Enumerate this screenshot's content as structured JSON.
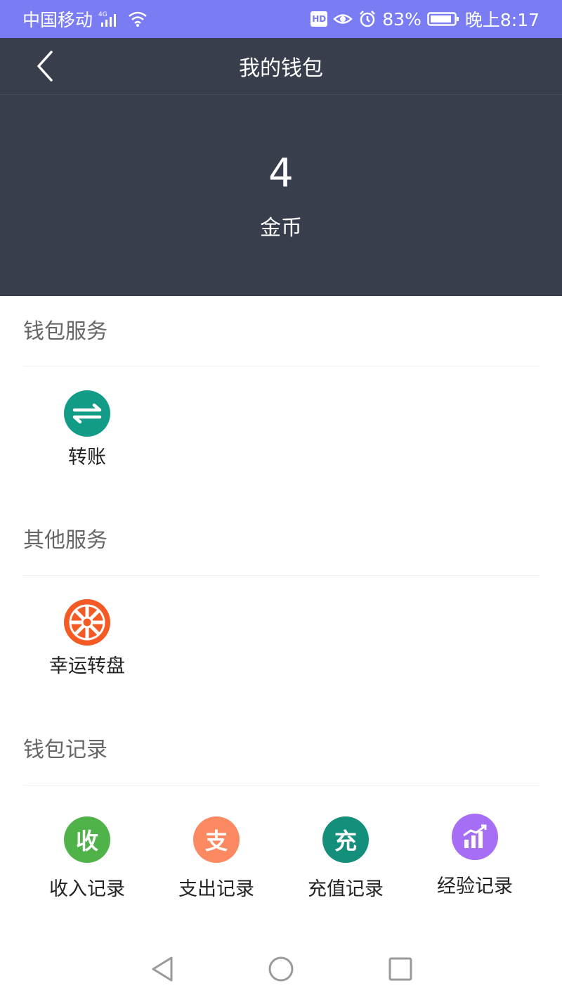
{
  "status_bar": {
    "carrier": "中国移动",
    "network": "4G",
    "hd": "HD",
    "battery": "83%",
    "time": "晚上8:17"
  },
  "app_bar": {
    "title": "我的钱包"
  },
  "balance": {
    "value": "4",
    "unit": "金币"
  },
  "sections": {
    "wallet_service": {
      "title": "钱包服务",
      "items": [
        {
          "label": "转账",
          "icon": "transfer-icon",
          "color": "#129c87"
        }
      ]
    },
    "other_service": {
      "title": "其他服务",
      "items": [
        {
          "label": "幸运转盘",
          "icon": "lucky-wheel-icon",
          "color": "#f35a24"
        }
      ]
    },
    "wallet_records": {
      "title": "钱包记录",
      "items": [
        {
          "label": "收入记录",
          "icon_text": "收",
          "color": "#4fb34a"
        },
        {
          "label": "支出记录",
          "icon_text": "支",
          "color": "#fb8961"
        },
        {
          "label": "充值记录",
          "icon_text": "充",
          "color": "#138f7c"
        },
        {
          "label": "经验记录",
          "icon": "bar-chart-icon",
          "color": "#a66ef5"
        }
      ]
    }
  }
}
